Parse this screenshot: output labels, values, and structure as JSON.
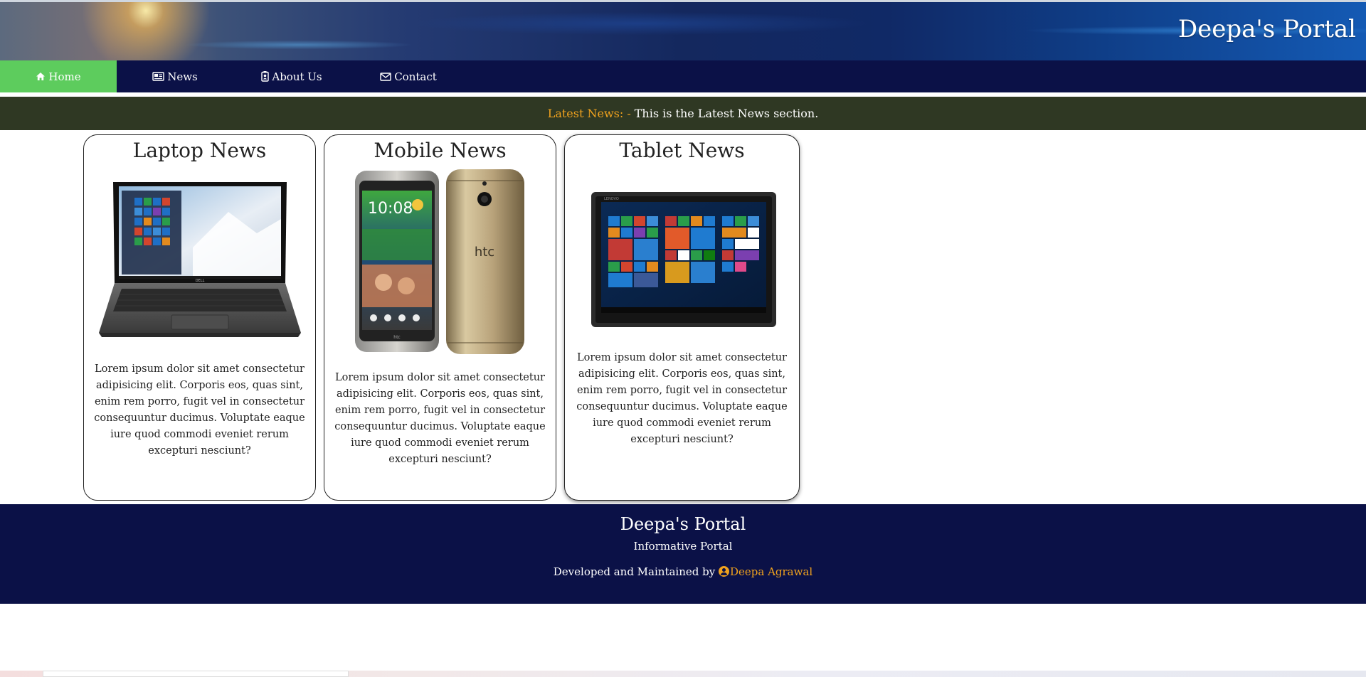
{
  "header": {
    "title": "Deepa's Portal"
  },
  "nav": {
    "items": [
      {
        "label": "Home",
        "icon": "home-icon",
        "active": true
      },
      {
        "label": "News",
        "icon": "newspaper-icon",
        "active": false
      },
      {
        "label": "About Us",
        "icon": "id-badge-icon",
        "active": false
      },
      {
        "label": "Contact",
        "icon": "envelope-icon",
        "active": false
      }
    ]
  },
  "ticker": {
    "label": "Latest News: -",
    "text": "This is the Latest News section."
  },
  "cards": [
    {
      "title": "Laptop News",
      "image": "laptop-image",
      "text": "Lorem ipsum dolor sit amet consectetur adipisicing elit. Corporis eos, quas sint, enim rem porro, fugit vel in consectetur consequuntur ducimus. Voluptate eaque iure quod commodi eveniet rerum excepturi nesciunt?"
    },
    {
      "title": "Mobile News",
      "image": "phone-image",
      "text": "Lorem ipsum dolor sit amet consectetur adipisicing elit. Corporis eos, quas sint, enim rem porro, fugit vel in consectetur consequuntur ducimus. Voluptate eaque iure quod commodi eveniet rerum excepturi nesciunt?"
    },
    {
      "title": "Tablet News",
      "image": "tablet-image",
      "text": "Lorem ipsum dolor sit amet consectetur adipisicing elit. Corporis eos, quas sint, enim rem porro, fugit vel in consectetur consequuntur ducimus. Voluptate eaque iure quod commodi eveniet rerum excepturi nesciunt?"
    }
  ],
  "images": {
    "laptop_brand": "DELL",
    "phone_time": "10:08",
    "phone_brand": "htc",
    "phone_brand_small": "htc",
    "tablet_brand": "LENOVO"
  },
  "footer": {
    "title": "Deepa's Portal",
    "subtitle": "Informative Portal",
    "developed_by": "Developed and Maintained by",
    "author": "Deepa Agrawal"
  },
  "colors": {
    "nav_bg": "#0b1147",
    "nav_active": "#5dcc5d",
    "ticker_bg": "#2f3823",
    "accent_orange": "#f0a21e"
  }
}
